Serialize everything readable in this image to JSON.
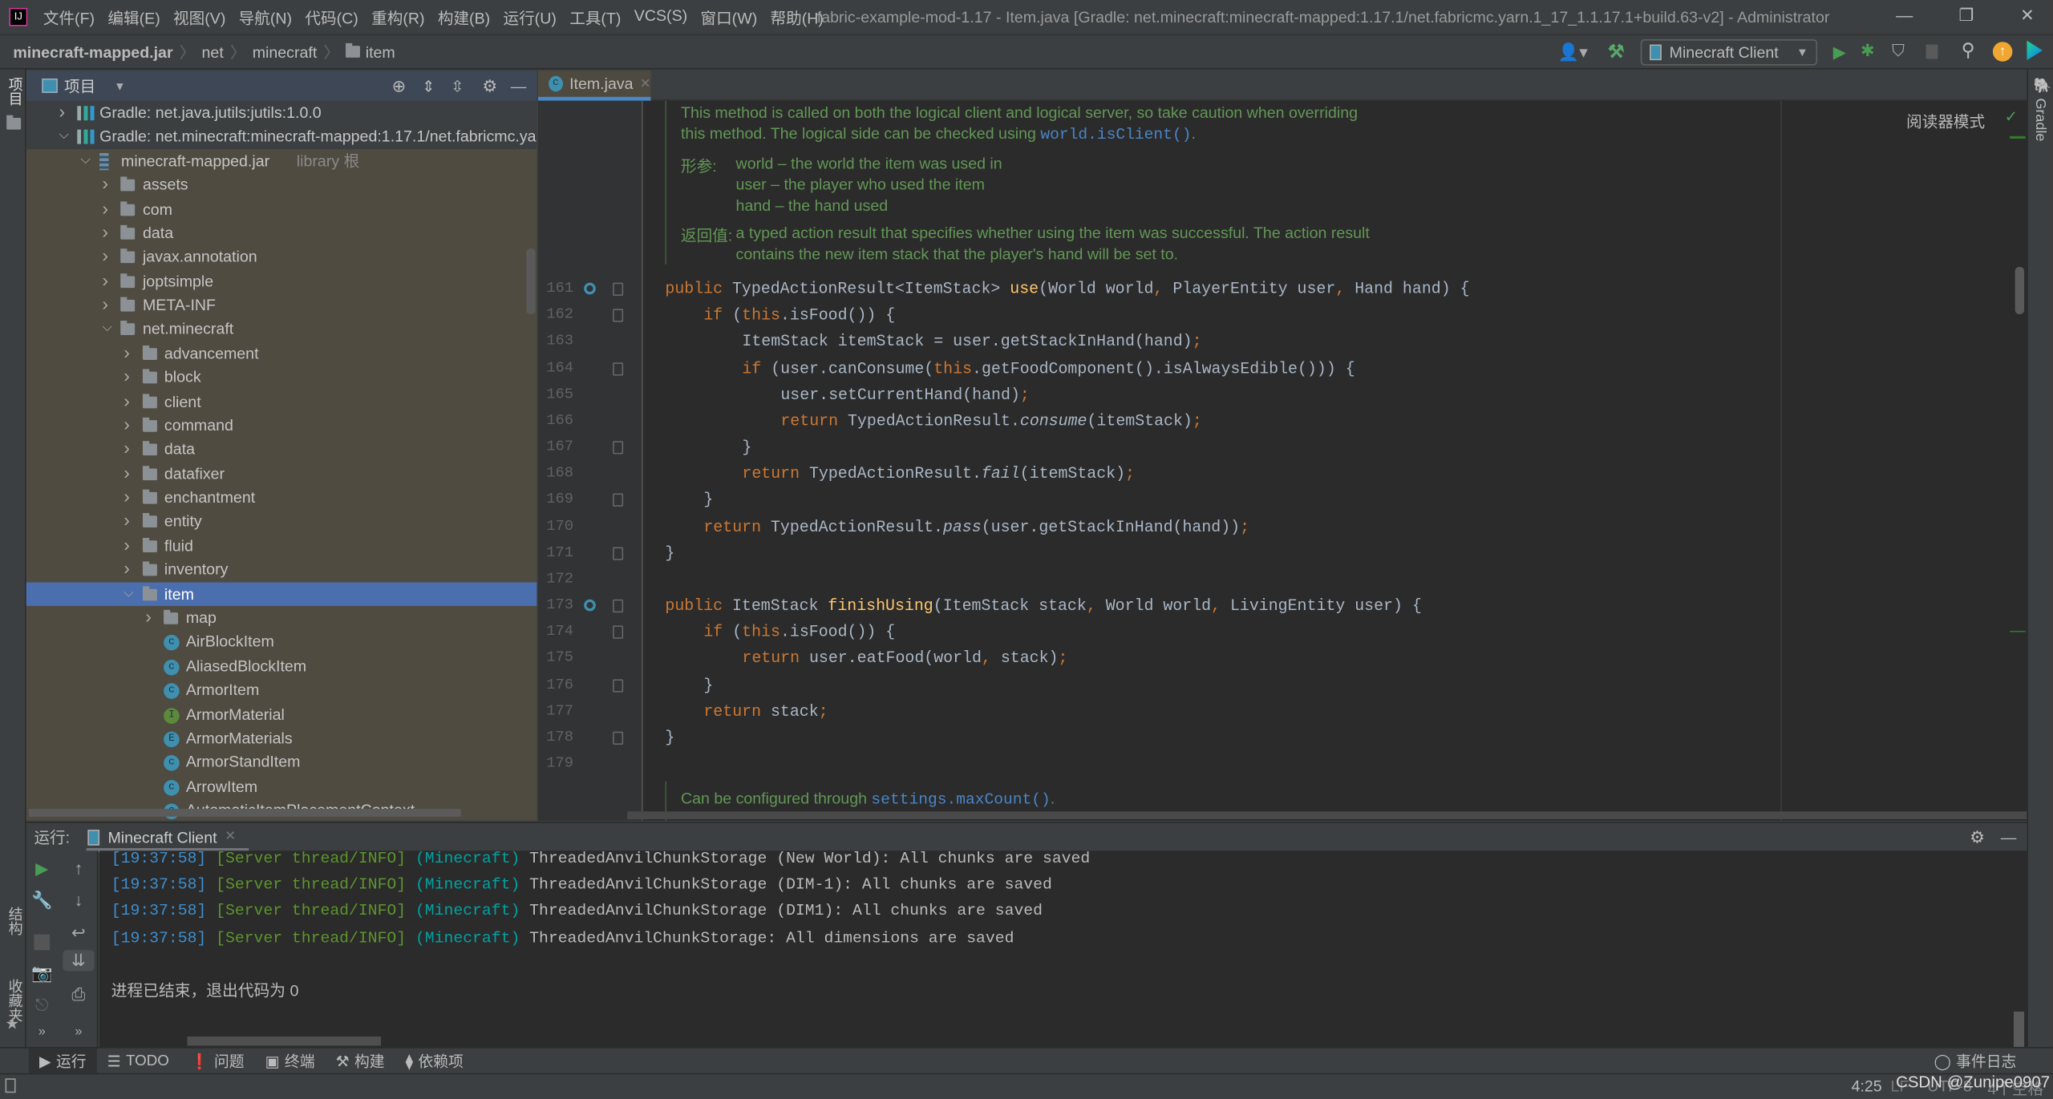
{
  "titlebar": {
    "menus": [
      "文件(F)",
      "编辑(E)",
      "视图(V)",
      "导航(N)",
      "代码(C)",
      "重构(R)",
      "构建(B)",
      "运行(U)",
      "工具(T)",
      "VCS(S)",
      "窗口(W)",
      "帮助(H)"
    ],
    "title": "fabric-example-mod-1.17 - Item.java [Gradle: net.minecraft:minecraft-mapped:1.17.1/net.fabricmc.yarn.1_17_1.1.17.1+build.63-v2] - Administrator"
  },
  "breadcrumb": [
    "minecraft-mapped.jar",
    "net",
    "minecraft",
    "item"
  ],
  "toolbar": {
    "run_config": "Minecraft Client"
  },
  "left_stripe": {
    "project": "项目",
    "structure": "结构",
    "favorites": "收藏夹"
  },
  "right_stripe": {
    "gradle": "Gradle"
  },
  "project": {
    "title": "项目",
    "tree": [
      {
        "label": "Gradle: net.java.jutils:jutils:1.0.0",
        "depth": 0,
        "type": "gradle",
        "arrow": "right"
      },
      {
        "label": "Gradle: net.minecraft:minecraft-mapped:1.17.1/net.fabricmc.yarn.1_17_1.1.17.1+build.63-v2",
        "depth": 0,
        "type": "gradle",
        "arrow": "down"
      },
      {
        "label": "minecraft-mapped.jar",
        "suffix": "library 根",
        "depth": 1,
        "type": "jar",
        "arrow": "down"
      },
      {
        "label": "assets",
        "depth": 2,
        "type": "folder",
        "arrow": "right"
      },
      {
        "label": "com",
        "depth": 2,
        "type": "folder",
        "arrow": "right"
      },
      {
        "label": "data",
        "depth": 2,
        "type": "folder",
        "arrow": "right"
      },
      {
        "label": "javax.annotation",
        "depth": 2,
        "type": "folder",
        "arrow": "right"
      },
      {
        "label": "joptsimple",
        "depth": 2,
        "type": "folder",
        "arrow": "right"
      },
      {
        "label": "META-INF",
        "depth": 2,
        "type": "folder",
        "arrow": "right"
      },
      {
        "label": "net.minecraft",
        "depth": 2,
        "type": "folder",
        "arrow": "down"
      },
      {
        "label": "advancement",
        "depth": 3,
        "type": "folder",
        "arrow": "right"
      },
      {
        "label": "block",
        "depth": 3,
        "type": "folder",
        "arrow": "right"
      },
      {
        "label": "client",
        "depth": 3,
        "type": "folder",
        "arrow": "right"
      },
      {
        "label": "command",
        "depth": 3,
        "type": "folder",
        "arrow": "right"
      },
      {
        "label": "data",
        "depth": 3,
        "type": "folder",
        "arrow": "right"
      },
      {
        "label": "datafixer",
        "depth": 3,
        "type": "folder",
        "arrow": "right"
      },
      {
        "label": "enchantment",
        "depth": 3,
        "type": "folder",
        "arrow": "right"
      },
      {
        "label": "entity",
        "depth": 3,
        "type": "folder",
        "arrow": "right"
      },
      {
        "label": "fluid",
        "depth": 3,
        "type": "folder",
        "arrow": "right"
      },
      {
        "label": "inventory",
        "depth": 3,
        "type": "folder",
        "arrow": "right"
      },
      {
        "label": "item",
        "depth": 3,
        "type": "folder",
        "arrow": "down",
        "selected": true
      },
      {
        "label": "map",
        "depth": 4,
        "type": "folder",
        "arrow": "right"
      },
      {
        "label": "AirBlockItem",
        "depth": 4,
        "type": "class"
      },
      {
        "label": "AliasedBlockItem",
        "depth": 4,
        "type": "class"
      },
      {
        "label": "ArmorItem",
        "depth": 4,
        "type": "class"
      },
      {
        "label": "ArmorMaterial",
        "depth": 4,
        "type": "interface"
      },
      {
        "label": "ArmorMaterials",
        "depth": 4,
        "type": "enum"
      },
      {
        "label": "ArmorStandItem",
        "depth": 4,
        "type": "class"
      },
      {
        "label": "ArrowItem",
        "depth": 4,
        "type": "class"
      },
      {
        "label": "AutomaticItemPlacementContext",
        "depth": 4,
        "type": "class"
      }
    ]
  },
  "editor": {
    "tab": "Item.java",
    "reader_mode": "阅读器模式",
    "doc_top": {
      "lines": [
        "This method is called on both the logical client and logical server, so take caution when overriding",
        "this method. The logical side can be checked using "
      ],
      "link": "world.isClient()",
      "params_label": "形参:",
      "params": [
        "world – the world the item was used in",
        "user – the player who used the item",
        "hand – the hand used"
      ],
      "returns_label": "返回值:",
      "returns": [
        "a typed action result that specifies whether using the item was successful. The action result",
        "contains the new item stack that the player's hand will be set to."
      ]
    },
    "lines": [
      {
        "n": "161",
        "indent": 0,
        "tokens": [
          [
            "public ",
            "k"
          ],
          [
            "TypedActionResult<ItemStack> ",
            "n"
          ],
          [
            "use",
            "m"
          ],
          [
            "(World world",
            "n"
          ],
          [
            ", ",
            "p"
          ],
          [
            "PlayerEntity user",
            "n"
          ],
          [
            ", ",
            "p"
          ],
          [
            "Hand hand) {",
            "n"
          ]
        ]
      },
      {
        "n": "162",
        "indent": 1,
        "tokens": [
          [
            "if ",
            "k"
          ],
          [
            "(",
            "n"
          ],
          [
            "this",
            "k"
          ],
          [
            ".isFood()) {",
            "n"
          ]
        ]
      },
      {
        "n": "163",
        "indent": 2,
        "tokens": [
          [
            "ItemStack itemStack = user.getStackInHand(hand)",
            "n"
          ],
          [
            ";",
            "p"
          ]
        ]
      },
      {
        "n": "164",
        "indent": 2,
        "tokens": [
          [
            "if ",
            "k"
          ],
          [
            "(user.canConsume(",
            "n"
          ],
          [
            "this",
            "k"
          ],
          [
            ".getFoodComponent().isAlwaysEdible())) {",
            "n"
          ]
        ]
      },
      {
        "n": "165",
        "indent": 3,
        "tokens": [
          [
            "user.setCurrentHand(hand)",
            "n"
          ],
          [
            ";",
            "p"
          ]
        ]
      },
      {
        "n": "166",
        "indent": 3,
        "tokens": [
          [
            "return ",
            "k"
          ],
          [
            "TypedActionResult.",
            "n"
          ],
          [
            "consume",
            "i"
          ],
          [
            "(itemStack)",
            "n"
          ],
          [
            ";",
            "p"
          ]
        ]
      },
      {
        "n": "167",
        "indent": 2,
        "tokens": [
          [
            "}",
            "n"
          ]
        ]
      },
      {
        "n": "168",
        "indent": 2,
        "tokens": [
          [
            "return ",
            "k"
          ],
          [
            "TypedActionResult.",
            "n"
          ],
          [
            "fail",
            "i"
          ],
          [
            "(itemStack)",
            "n"
          ],
          [
            ";",
            "p"
          ]
        ]
      },
      {
        "n": "169",
        "indent": 1,
        "tokens": [
          [
            "}",
            "n"
          ]
        ]
      },
      {
        "n": "170",
        "indent": 1,
        "tokens": [
          [
            "return ",
            "k"
          ],
          [
            "TypedActionResult.",
            "n"
          ],
          [
            "pass",
            "i"
          ],
          [
            "(user.getStackInHand(hand))",
            "n"
          ],
          [
            ";",
            "p"
          ]
        ]
      },
      {
        "n": "171",
        "indent": 0,
        "tokens": [
          [
            "}",
            "n"
          ]
        ]
      },
      {
        "n": "172",
        "indent": 0,
        "tokens": []
      },
      {
        "n": "173",
        "indent": 0,
        "tokens": [
          [
            "public ",
            "k"
          ],
          [
            "ItemStack ",
            "n"
          ],
          [
            "finishUsing",
            "m"
          ],
          [
            "(ItemStack stack",
            "n"
          ],
          [
            ", ",
            "p"
          ],
          [
            "World world",
            "n"
          ],
          [
            ", ",
            "p"
          ],
          [
            "LivingEntity user) {",
            "n"
          ]
        ]
      },
      {
        "n": "174",
        "indent": 1,
        "tokens": [
          [
            "if ",
            "k"
          ],
          [
            "(",
            "n"
          ],
          [
            "this",
            "k"
          ],
          [
            ".isFood()) {",
            "n"
          ]
        ]
      },
      {
        "n": "175",
        "indent": 2,
        "tokens": [
          [
            "return ",
            "k"
          ],
          [
            "user.eatFood(world",
            "n"
          ],
          [
            ", ",
            "p"
          ],
          [
            "stack)",
            "n"
          ],
          [
            ";",
            "p"
          ]
        ]
      },
      {
        "n": "176",
        "indent": 1,
        "tokens": [
          [
            "}",
            "n"
          ]
        ]
      },
      {
        "n": "177",
        "indent": 1,
        "tokens": [
          [
            "return ",
            "k"
          ],
          [
            "stack",
            "n"
          ],
          [
            ";",
            "p"
          ]
        ]
      },
      {
        "n": "178",
        "indent": 0,
        "tokens": [
          [
            "}",
            "n"
          ]
        ]
      },
      {
        "n": "179",
        "indent": 0,
        "tokens": []
      }
    ],
    "doc_bottom": {
      "text": "Can be configured through ",
      "link": "settings.maxCount()",
      "end": "."
    }
  },
  "run": {
    "label": "运行:",
    "tab": "Minecraft Client",
    "lines": [
      {
        "ts": "[19:37:58] ",
        "th": "[Server thread/INFO] ",
        "mc": "(Minecraft) ",
        "tx": "ThreadedAnvilChunkStorage (New World): All chunks are saved"
      },
      {
        "ts": "[19:37:58] ",
        "th": "[Server thread/INFO] ",
        "mc": "(Minecraft) ",
        "tx": "ThreadedAnvilChunkStorage (DIM-1): All chunks are saved"
      },
      {
        "ts": "[19:37:58] ",
        "th": "[Server thread/INFO] ",
        "mc": "(Minecraft) ",
        "tx": "ThreadedAnvilChunkStorage (DIM1): All chunks are saved"
      },
      {
        "ts": "[19:37:58] ",
        "th": "[Server thread/INFO] ",
        "mc": "(Minecraft) ",
        "tx": "ThreadedAnvilChunkStorage: All dimensions are saved"
      }
    ],
    "exit": "进程已结束，退出代码为 0"
  },
  "bottom_tools": [
    "运行",
    "TODO",
    "问题",
    "终端",
    "构建",
    "依赖项"
  ],
  "event_log": "事件日志",
  "status": {
    "position": "4:25",
    "line_sep": "LF",
    "encoding": "UTF-8",
    "indent": "4个空格"
  },
  "watermark": "CSDN @Zunipe0907",
  "colors": {
    "keyword": "#cc7832",
    "method": "#ffc66d",
    "text": "#a9b7c6",
    "doc": "#629755",
    "selection": "#4b6eaf",
    "timestamp": "#3d8fd1",
    "thread": "#5c962c",
    "logger": "#00a3a3"
  }
}
